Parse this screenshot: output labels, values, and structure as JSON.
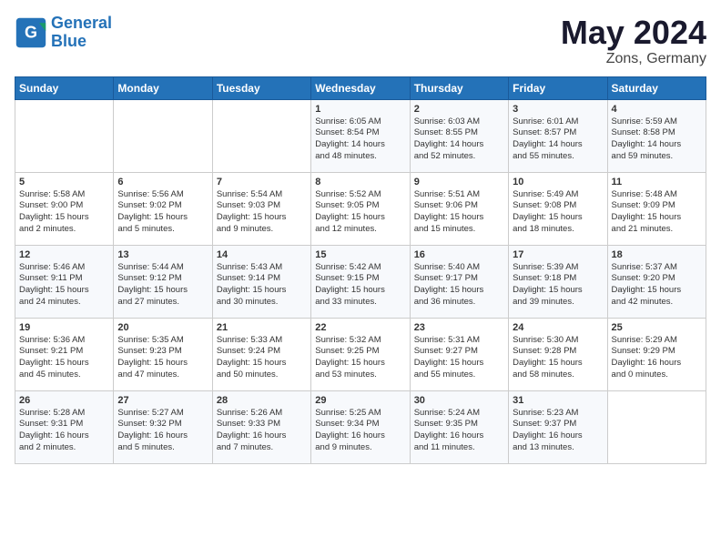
{
  "logo": {
    "line1": "General",
    "line2": "Blue"
  },
  "title": "May 2024",
  "location": "Zons, Germany",
  "days_header": [
    "Sunday",
    "Monday",
    "Tuesday",
    "Wednesday",
    "Thursday",
    "Friday",
    "Saturday"
  ],
  "weeks": [
    [
      {
        "day": "",
        "info": ""
      },
      {
        "day": "",
        "info": ""
      },
      {
        "day": "",
        "info": ""
      },
      {
        "day": "1",
        "info": "Sunrise: 6:05 AM\nSunset: 8:54 PM\nDaylight: 14 hours\nand 48 minutes."
      },
      {
        "day": "2",
        "info": "Sunrise: 6:03 AM\nSunset: 8:55 PM\nDaylight: 14 hours\nand 52 minutes."
      },
      {
        "day": "3",
        "info": "Sunrise: 6:01 AM\nSunset: 8:57 PM\nDaylight: 14 hours\nand 55 minutes."
      },
      {
        "day": "4",
        "info": "Sunrise: 5:59 AM\nSunset: 8:58 PM\nDaylight: 14 hours\nand 59 minutes."
      }
    ],
    [
      {
        "day": "5",
        "info": "Sunrise: 5:58 AM\nSunset: 9:00 PM\nDaylight: 15 hours\nand 2 minutes."
      },
      {
        "day": "6",
        "info": "Sunrise: 5:56 AM\nSunset: 9:02 PM\nDaylight: 15 hours\nand 5 minutes."
      },
      {
        "day": "7",
        "info": "Sunrise: 5:54 AM\nSunset: 9:03 PM\nDaylight: 15 hours\nand 9 minutes."
      },
      {
        "day": "8",
        "info": "Sunrise: 5:52 AM\nSunset: 9:05 PM\nDaylight: 15 hours\nand 12 minutes."
      },
      {
        "day": "9",
        "info": "Sunrise: 5:51 AM\nSunset: 9:06 PM\nDaylight: 15 hours\nand 15 minutes."
      },
      {
        "day": "10",
        "info": "Sunrise: 5:49 AM\nSunset: 9:08 PM\nDaylight: 15 hours\nand 18 minutes."
      },
      {
        "day": "11",
        "info": "Sunrise: 5:48 AM\nSunset: 9:09 PM\nDaylight: 15 hours\nand 21 minutes."
      }
    ],
    [
      {
        "day": "12",
        "info": "Sunrise: 5:46 AM\nSunset: 9:11 PM\nDaylight: 15 hours\nand 24 minutes."
      },
      {
        "day": "13",
        "info": "Sunrise: 5:44 AM\nSunset: 9:12 PM\nDaylight: 15 hours\nand 27 minutes."
      },
      {
        "day": "14",
        "info": "Sunrise: 5:43 AM\nSunset: 9:14 PM\nDaylight: 15 hours\nand 30 minutes."
      },
      {
        "day": "15",
        "info": "Sunrise: 5:42 AM\nSunset: 9:15 PM\nDaylight: 15 hours\nand 33 minutes."
      },
      {
        "day": "16",
        "info": "Sunrise: 5:40 AM\nSunset: 9:17 PM\nDaylight: 15 hours\nand 36 minutes."
      },
      {
        "day": "17",
        "info": "Sunrise: 5:39 AM\nSunset: 9:18 PM\nDaylight: 15 hours\nand 39 minutes."
      },
      {
        "day": "18",
        "info": "Sunrise: 5:37 AM\nSunset: 9:20 PM\nDaylight: 15 hours\nand 42 minutes."
      }
    ],
    [
      {
        "day": "19",
        "info": "Sunrise: 5:36 AM\nSunset: 9:21 PM\nDaylight: 15 hours\nand 45 minutes."
      },
      {
        "day": "20",
        "info": "Sunrise: 5:35 AM\nSunset: 9:23 PM\nDaylight: 15 hours\nand 47 minutes."
      },
      {
        "day": "21",
        "info": "Sunrise: 5:33 AM\nSunset: 9:24 PM\nDaylight: 15 hours\nand 50 minutes."
      },
      {
        "day": "22",
        "info": "Sunrise: 5:32 AM\nSunset: 9:25 PM\nDaylight: 15 hours\nand 53 minutes."
      },
      {
        "day": "23",
        "info": "Sunrise: 5:31 AM\nSunset: 9:27 PM\nDaylight: 15 hours\nand 55 minutes."
      },
      {
        "day": "24",
        "info": "Sunrise: 5:30 AM\nSunset: 9:28 PM\nDaylight: 15 hours\nand 58 minutes."
      },
      {
        "day": "25",
        "info": "Sunrise: 5:29 AM\nSunset: 9:29 PM\nDaylight: 16 hours\nand 0 minutes."
      }
    ],
    [
      {
        "day": "26",
        "info": "Sunrise: 5:28 AM\nSunset: 9:31 PM\nDaylight: 16 hours\nand 2 minutes."
      },
      {
        "day": "27",
        "info": "Sunrise: 5:27 AM\nSunset: 9:32 PM\nDaylight: 16 hours\nand 5 minutes."
      },
      {
        "day": "28",
        "info": "Sunrise: 5:26 AM\nSunset: 9:33 PM\nDaylight: 16 hours\nand 7 minutes."
      },
      {
        "day": "29",
        "info": "Sunrise: 5:25 AM\nSunset: 9:34 PM\nDaylight: 16 hours\nand 9 minutes."
      },
      {
        "day": "30",
        "info": "Sunrise: 5:24 AM\nSunset: 9:35 PM\nDaylight: 16 hours\nand 11 minutes."
      },
      {
        "day": "31",
        "info": "Sunrise: 5:23 AM\nSunset: 9:37 PM\nDaylight: 16 hours\nand 13 minutes."
      },
      {
        "day": "",
        "info": ""
      }
    ]
  ]
}
